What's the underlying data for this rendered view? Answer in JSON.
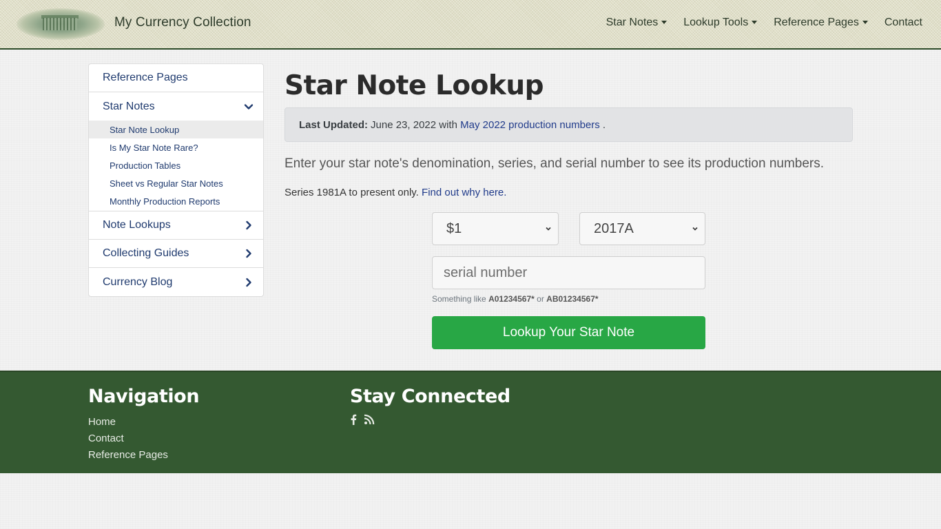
{
  "header": {
    "brand": "My Currency Collection",
    "logo_icon": "treasury-building-engraving",
    "nav": [
      {
        "label": "Star Notes",
        "dropdown": true
      },
      {
        "label": "Lookup Tools",
        "dropdown": true
      },
      {
        "label": "Reference Pages",
        "dropdown": true
      },
      {
        "label": "Contact",
        "dropdown": false
      }
    ]
  },
  "sidebar": {
    "items": [
      {
        "label": "Reference Pages"
      },
      {
        "label": "Star Notes",
        "expanded": true,
        "icon": "chevron-down-icon",
        "children": [
          {
            "label": "Star Note Lookup",
            "active": true
          },
          {
            "label": "Is My Star Note Rare?"
          },
          {
            "label": "Production Tables"
          },
          {
            "label": "Sheet vs Regular Star Notes"
          },
          {
            "label": "Monthly Production Reports"
          }
        ]
      },
      {
        "label": "Note Lookups",
        "icon": "chevron-right-icon"
      },
      {
        "label": "Collecting Guides",
        "icon": "chevron-right-icon"
      },
      {
        "label": "Currency Blog",
        "icon": "chevron-right-icon"
      }
    ]
  },
  "main": {
    "title": "Star Note Lookup",
    "alert": {
      "label": "Last Updated:",
      "date_text": "June 23, 2022 with",
      "link": "May 2022 production numbers",
      "suffix": "."
    },
    "lead": "Enter your star note's denomination, series, and serial number to see its production numbers.",
    "note": {
      "text": "Series 1981A to present only.",
      "link": "Find out why here."
    },
    "form": {
      "denomination": {
        "selected": "$1"
      },
      "series": {
        "selected": "2017A"
      },
      "serial": {
        "value": "",
        "placeholder": "serial number"
      },
      "help": {
        "prefix": "Something like",
        "example1": "A01234567*",
        "middle": "or",
        "example2": "AB01234567*"
      },
      "submit_label": "Lookup Your Star Note"
    }
  },
  "footer": {
    "navigation": {
      "heading": "Navigation",
      "links": [
        "Home",
        "Contact",
        "Reference Pages"
      ]
    },
    "connect": {
      "heading": "Stay Connected",
      "icons": [
        "facebook-icon",
        "rss-icon"
      ]
    }
  },
  "colors": {
    "header_bg": "#e0dfc8",
    "link": "#1f3a8a",
    "button": "#28a745",
    "footer_bg": "#345931"
  }
}
